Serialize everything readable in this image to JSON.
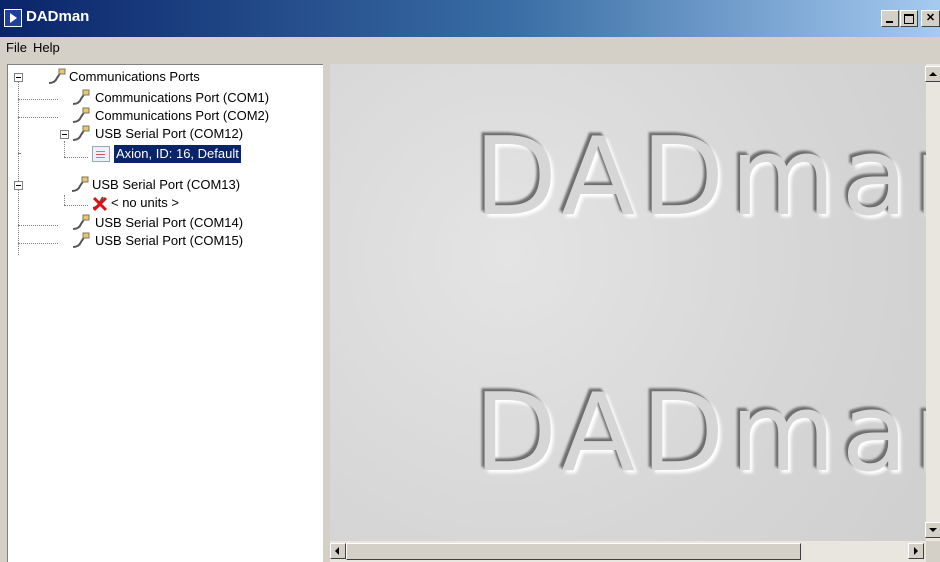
{
  "window": {
    "title": "DADman",
    "buttons": [
      "minimize",
      "maximize",
      "close"
    ]
  },
  "menu": {
    "items": [
      "File",
      "Help"
    ]
  },
  "tree": {
    "root": "Communications Ports",
    "nodes": [
      {
        "label": "Communications Port (COM1)",
        "icon": "serial-cable-icon"
      },
      {
        "label": "Communications Port (COM2)",
        "icon": "serial-cable-icon"
      },
      {
        "label": "USB Serial Port (COM12)",
        "icon": "serial-cable-icon",
        "expanded": true,
        "children": [
          {
            "label": "Axion, ID: 16, Default",
            "icon": "unit-icon",
            "selected": true
          }
        ]
      },
      {
        "label": "USB Serial Port (COM13)",
        "icon": "serial-cable-icon",
        "expanded": true,
        "children": [
          {
            "label": "< no units >",
            "icon": "no-units-x-icon"
          }
        ]
      },
      {
        "label": "USB Serial Port (COM14)",
        "icon": "serial-cable-icon"
      },
      {
        "label": "USB Serial Port (COM15)",
        "icon": "serial-cable-icon"
      }
    ]
  },
  "splash": {
    "logo_text_1": "DADman",
    "logo_text_2": "DADman"
  },
  "colors": {
    "selection": "#0a246a",
    "titlebar_start": "#0a246a",
    "window_face": "#d4d0c8"
  }
}
